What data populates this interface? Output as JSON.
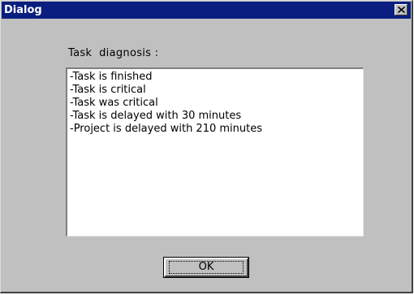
{
  "window": {
    "title": "Dialog",
    "titlebar_color": "#0a1e80",
    "background_color": "#c0c0c0"
  },
  "close_button": {
    "icon": "close-icon"
  },
  "diagnosis": {
    "label": "Task  diagnosis :",
    "items": [
      "-Task is finished",
      "-Task is critical",
      "-Task was critical",
      "-Task is delayed with 30 minutes",
      "-Project is delayed with 210 minutes"
    ]
  },
  "buttons": {
    "ok_label": "OK"
  }
}
